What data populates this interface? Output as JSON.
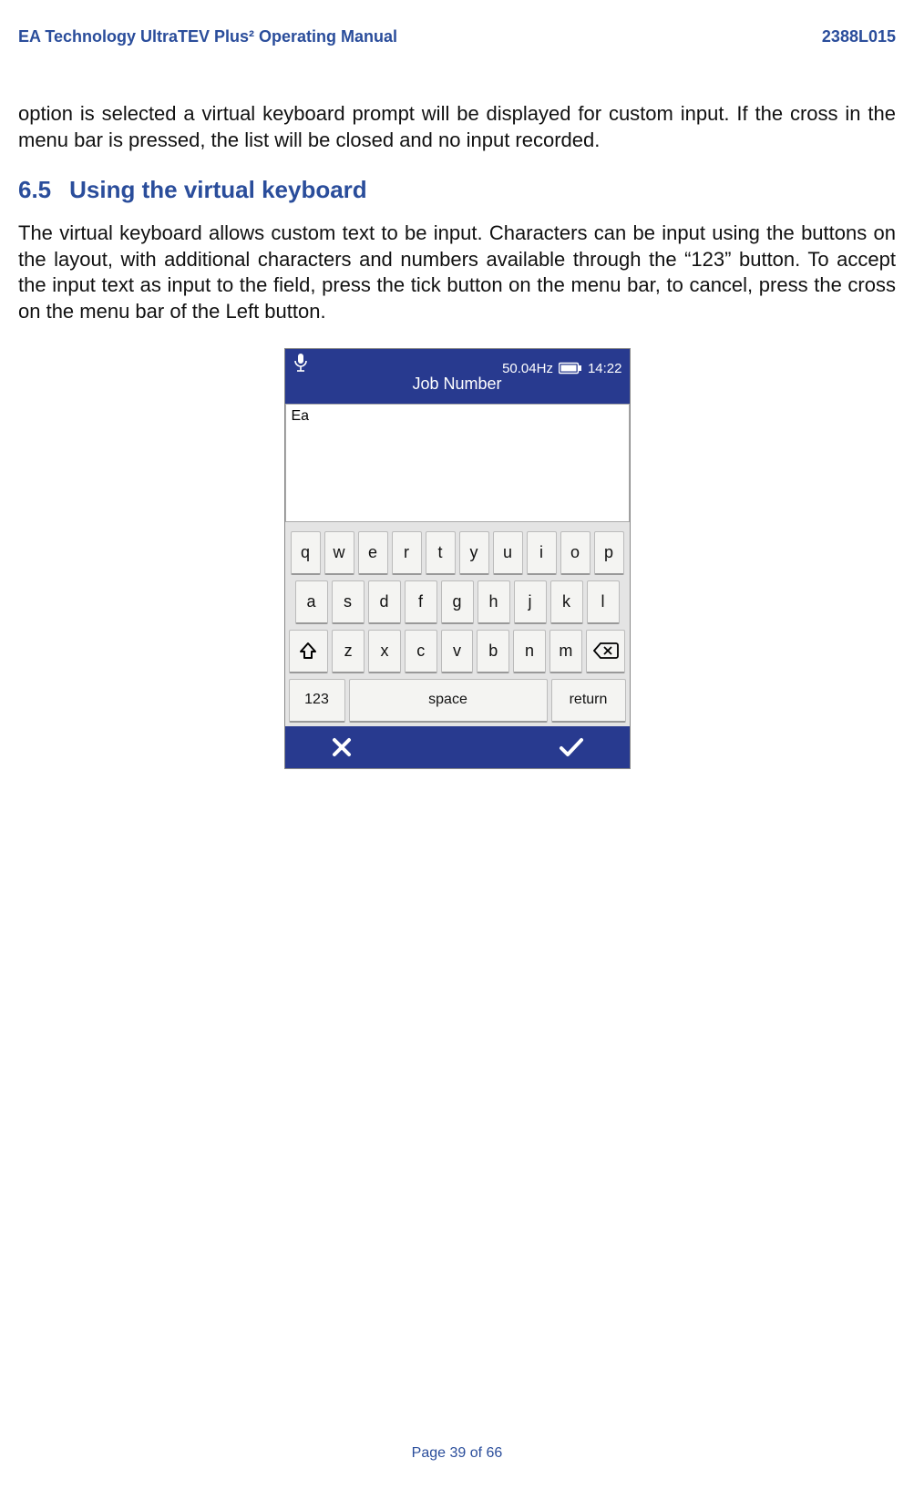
{
  "header": {
    "left": "EA Technology UltraTEV Plus² Operating Manual",
    "right": "2388L015"
  },
  "intro_paragraph": "option is selected a virtual keyboard prompt will be displayed for custom input. If the cross in the menu bar is pressed, the list will be closed and no input recorded.",
  "section": {
    "number": "6.5",
    "title": "Using the virtual keyboard",
    "body": "The virtual keyboard allows custom text to be input. Characters can be input using the buttons on the layout, with additional characters and numbers available through the “123” button. To accept the input text as input to the field, press the tick button on the menu bar, to cancel, press the cross on the menu bar of the Left button."
  },
  "device": {
    "status": {
      "frequency": "50.04Hz",
      "time": "14:22",
      "title": "Job Number"
    },
    "input_value": "Ea",
    "keyboard": {
      "row1": [
        "q",
        "w",
        "e",
        "r",
        "t",
        "y",
        "u",
        "i",
        "o",
        "p"
      ],
      "row2": [
        "a",
        "s",
        "d",
        "f",
        "g",
        "h",
        "j",
        "k",
        "l"
      ],
      "row3": [
        "z",
        "x",
        "c",
        "v",
        "b",
        "n",
        "m"
      ],
      "k123": "123",
      "space": "space",
      "return": "return"
    }
  },
  "footer": "Page 39 of 66"
}
